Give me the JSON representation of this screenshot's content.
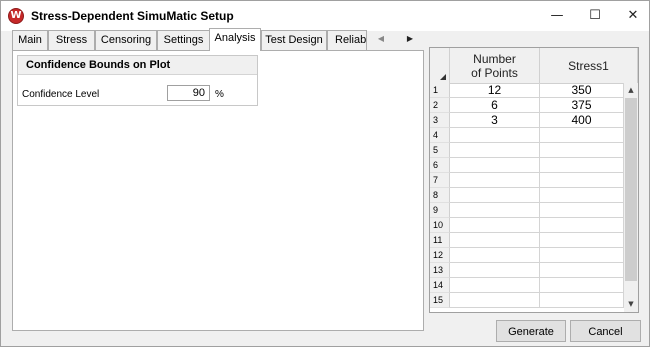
{
  "window": {
    "title": "Stress-Dependent SimuMatic Setup",
    "icon_letter": "W",
    "minimize_glyph": "—",
    "maximize_glyph": "☐",
    "close_glyph": "✕"
  },
  "tabs": [
    {
      "label": "Main",
      "active": false
    },
    {
      "label": "Stress",
      "active": false
    },
    {
      "label": "Censoring",
      "active": false
    },
    {
      "label": "Settings",
      "active": false
    },
    {
      "label": "Analysis",
      "active": true
    },
    {
      "label": "Test Design",
      "active": false
    },
    {
      "label": "Reliabil",
      "active": false
    }
  ],
  "tab_scroll": {
    "left_glyph": "◀",
    "right_glyph": "▶"
  },
  "analysis": {
    "group_title": "Confidence Bounds on Plot",
    "confidence_label": "Confidence Level",
    "confidence_value": "90",
    "confidence_unit": "%"
  },
  "grid": {
    "columns": [
      "Number of Points",
      "Stress1"
    ],
    "row_numbers": [
      "1",
      "2",
      "3",
      "4",
      "5",
      "6",
      "7",
      "8",
      "9",
      "10",
      "11",
      "12",
      "13",
      "14",
      "15"
    ],
    "rows": [
      [
        "12",
        "350"
      ],
      [
        "6",
        "375"
      ],
      [
        "3",
        "400"
      ],
      [
        "",
        ""
      ],
      [
        "",
        ""
      ],
      [
        "",
        ""
      ],
      [
        "",
        ""
      ],
      [
        "",
        ""
      ],
      [
        "",
        ""
      ],
      [
        "",
        ""
      ],
      [
        "",
        ""
      ],
      [
        "",
        ""
      ],
      [
        "",
        ""
      ],
      [
        "",
        ""
      ],
      [
        "",
        ""
      ]
    ],
    "scroll_up_glyph": "▲",
    "scroll_down_glyph": "▼"
  },
  "buttons": {
    "generate": "Generate",
    "cancel": "Cancel"
  }
}
